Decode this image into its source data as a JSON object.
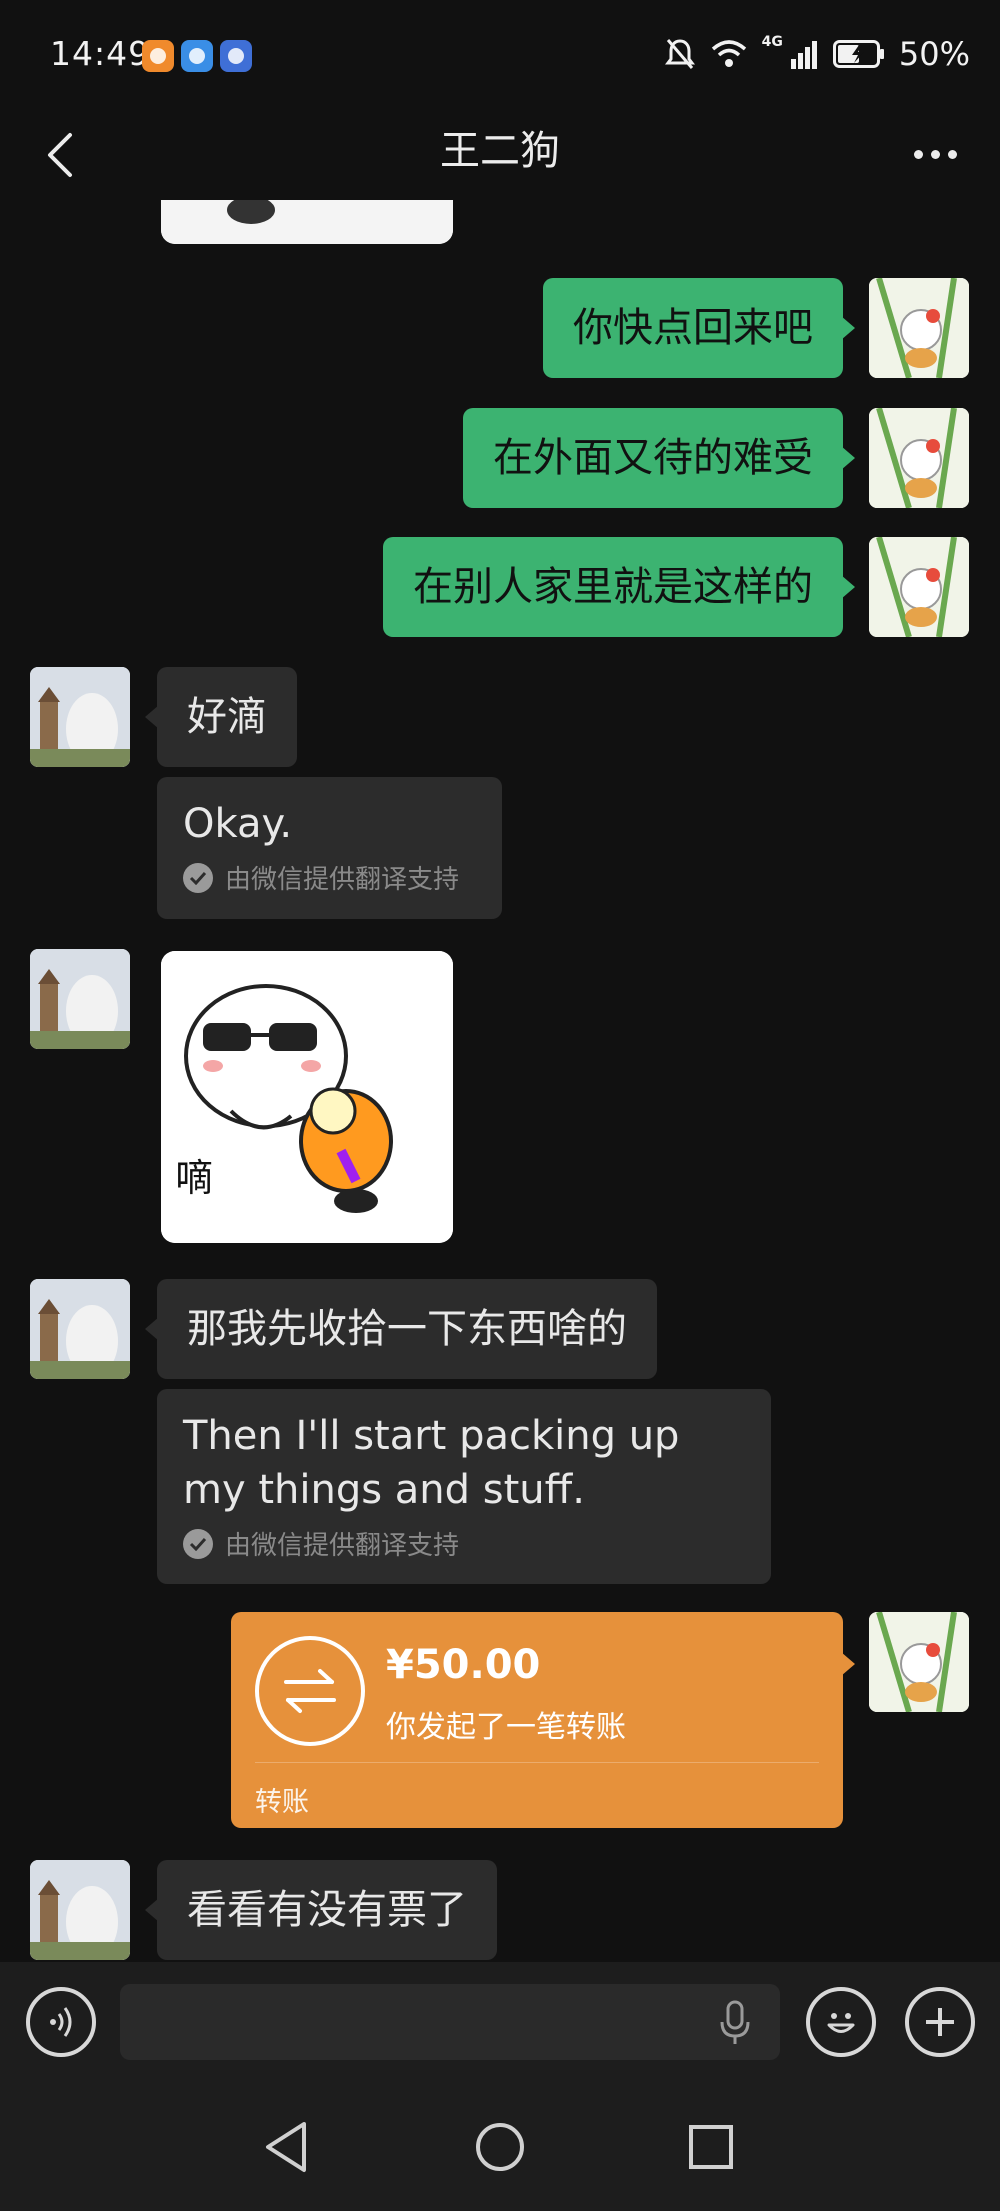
{
  "status_bar": {
    "time": "14:49",
    "network": "4G",
    "battery": "50%"
  },
  "header": {
    "title": "王二狗"
  },
  "messages": {
    "out_1": "你快点回来吧",
    "out_2": "在外面又待的难受",
    "out_3": "在别人家里就是这样的",
    "in_1": "好滴",
    "in_1_translation": "Okay.",
    "translation_note": "由微信提供翻译支持",
    "sticker_text": "嘀",
    "in_2": "那我先收拾一下东西啥的",
    "in_2_translation": "Then I'll start packing up my things and stuff.",
    "in_3": "看看有没有票了"
  },
  "transfer": {
    "amount": "¥50.00",
    "description": "你发起了一笔转账",
    "label": "转账"
  },
  "colors": {
    "outgoing_bubble": "#3cb371",
    "incoming_bubble": "#2c2c2c",
    "transfer_card": "#e6913b",
    "background": "#111111"
  },
  "icons": [
    "back-icon",
    "more-icon",
    "voice-icon",
    "mic-icon",
    "emoji-icon",
    "plus-icon",
    "nav-back-icon",
    "nav-home-icon",
    "nav-recents-icon"
  ]
}
